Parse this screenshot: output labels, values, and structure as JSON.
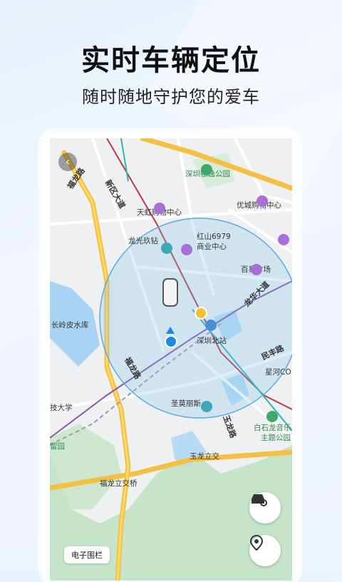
{
  "header": {
    "title": "实时车辆定位",
    "subtitle": "随时随地守护您的爱车"
  },
  "map": {
    "pois": {
      "deyi_park": "深圳德逸公园",
      "tianhong": "天虹购物中心",
      "youcheng": "优城购物中心",
      "longguang": "龙光玖钻",
      "hongshan_1": "红山6979",
      "hongshan_2": "商业中心",
      "baiyi": "百易广场",
      "shenzhen_north": "深圳北站",
      "changling": "长岭皮水库",
      "xinghe": "星河CO",
      "shengmo": "圣莫丽斯",
      "baishilong_1": "白石龙音乐",
      "baishilong_2": "主题公园",
      "university": "技大学",
      "park_left": "留园",
      "yulong_interchange": "玉龙立交",
      "fulong_interchange": "福龙立交桥"
    },
    "roads": {
      "fulong_road_top": "福龙路",
      "fulong_road_mid": "福龙路",
      "xinqu_avenue": "新区大道",
      "longhua_avenue": "龙华大道",
      "minfeng_road": "民丰路",
      "yulong_road": "玉龙路"
    },
    "fence_button": "电子围栏"
  },
  "colors": {
    "accent": "#1e88e5",
    "geofence": "#5aa9e6",
    "rail": "#c0394b",
    "highway": "#f5c542"
  }
}
